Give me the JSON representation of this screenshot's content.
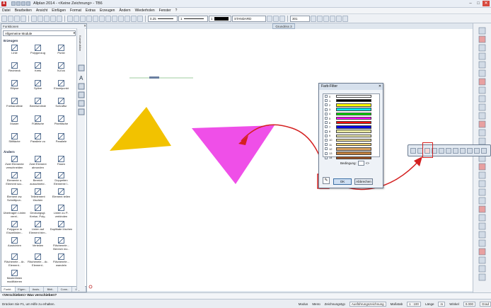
{
  "window": {
    "title": "Allplan 2014 - <Keine Zeichnung> - TB6"
  },
  "menu": [
    "Datei",
    "Bearbeiten",
    "Ansicht",
    "Einfügen",
    "Format",
    "Extras",
    "Erzeugen",
    "Ändern",
    "Wiederholen",
    "Fenster",
    "?"
  ],
  "toolbar": {
    "pen_value": "0.25",
    "line_value": "1",
    "color_value": "1",
    "layer_value": "STANDARD",
    "format_value": "301"
  },
  "document_tab": "Grundriss 3",
  "panel": {
    "title": "Funktionen",
    "module_select": "Allgemeine Module",
    "side_label": "Konstruktion",
    "section_create": "Erzeugen",
    "create_tools": [
      {
        "label": "Linie",
        "icon": "line-icon"
      },
      {
        "label": "Polygonzug",
        "icon": "polyline-icon"
      },
      {
        "label": "Punkt",
        "icon": "point-icon"
      },
      {
        "label": "Rechteck",
        "icon": "rectangle-icon"
      },
      {
        "label": "Kreis",
        "icon": "circle-icon"
      },
      {
        "label": "N-Eck",
        "icon": "polygon-icon"
      },
      {
        "label": "Ellipse",
        "icon": "ellipse-icon"
      },
      {
        "label": "Spline",
        "icon": "spline-icon"
      },
      {
        "label": "Einzelpunkt",
        "icon": "single-point-icon"
      },
      {
        "label": "Freihandlinie",
        "icon": "freehand-icon"
      },
      {
        "label": "Bereisenlinie",
        "icon": "contour-icon"
      },
      {
        "label": "Schraffur",
        "icon": "hatch-icon"
      },
      {
        "label": "Muster",
        "icon": "pattern-icon"
      },
      {
        "label": "Füllfläche",
        "icon": "fill-icon"
      },
      {
        "label": "Pixelfläche",
        "icon": "pixel-fill-icon"
      },
      {
        "label": "Stilfläche",
        "icon": "style-area-icon"
      },
      {
        "label": "Parallele zu",
        "icon": "parallel-icon"
      },
      {
        "label": "Parallele",
        "icon": "parallel-lines-icon"
      }
    ],
    "section_modify": "Ändern",
    "modify_tools": [
      {
        "label": "Zwei Elemente verschneiden",
        "icon": "intersect-icon"
      },
      {
        "label": "Zwei Element abrunden",
        "icon": "fillet-icon"
      },
      {
        "label": "Fasen",
        "icon": "chamfer-icon"
      },
      {
        "label": "Elemente u. Element scu..",
        "icon": "trim-icon"
      },
      {
        "label": "Bereich ausschneid..",
        "icon": "cut-area-icon"
      },
      {
        "label": "Doppelten Elemente l..",
        "icon": "duplicate-icon"
      },
      {
        "label": "Element zw. Schnittpun..",
        "icon": "between-icon"
      },
      {
        "label": "Teilelement löschen",
        "icon": "delete-part-icon"
      },
      {
        "label": "Element teilen",
        "icon": "split-icon"
      },
      {
        "label": "Übertragen Linien verei..",
        "icon": "transfer-icon"
      },
      {
        "label": "Deckungsgl. Kreise, Poly..",
        "icon": "congruent-icon"
      },
      {
        "label": "Linien zu P.. verbinden",
        "icon": "join-icon"
      },
      {
        "label": "Polygone in Einzellinien..",
        "icon": "explode-icon"
      },
      {
        "label": "Linien auf Element trim..",
        "icon": "trim-line-icon"
      },
      {
        "label": "Duplikate löschen",
        "icon": "delete-duplicates-icon"
      },
      {
        "label": "Ausrichten",
        "icon": "align-icon"
      },
      {
        "label": "Verteilen",
        "icon": "distribute-icon"
      },
      {
        "label": "Flächenele... Bereich mo..",
        "icon": "area-modify-icon"
      },
      {
        "label": "Flächenele... Ar-Element..",
        "icon": "area-element-icon"
      },
      {
        "label": "Flächenele... Ar-Element..",
        "icon": "area-element2-icon"
      },
      {
        "label": "Flächenele... wandeln",
        "icon": "area-convert-icon"
      },
      {
        "label": "Musterlinien modifizieren",
        "icon": "pattern-line-icon"
      }
    ],
    "tabs": [
      "Funkt..",
      "Eigen..",
      "Assis..",
      "Bibli..",
      "Conn..",
      "Layer"
    ]
  },
  "dialog": {
    "title": "Farb-Filter",
    "colors": [
      {
        "num": "0",
        "hex": "#ffffff"
      },
      {
        "num": "1",
        "hex": "#000000"
      },
      {
        "num": "2",
        "hex": "#ffff00"
      },
      {
        "num": "3",
        "hex": "#00e5e5"
      },
      {
        "num": "4",
        "hex": "#00e000"
      },
      {
        "num": "5",
        "hex": "#ff00ff"
      },
      {
        "num": "6",
        "hex": "#ff0000"
      },
      {
        "num": "7",
        "hex": "#0000e0"
      },
      {
        "num": "8",
        "hex": "#e8e8a0"
      },
      {
        "num": "9",
        "hex": "#f2f0b0"
      },
      {
        "num": "10",
        "hex": "#e8d890"
      },
      {
        "num": "11",
        "hex": "#f0d070"
      },
      {
        "num": "12",
        "hex": "#d8a060"
      },
      {
        "num": "13",
        "hex": "#c08040"
      },
      {
        "num": "14",
        "hex": "#a05020"
      }
    ],
    "condition_label": "Bedingung:",
    "condition_symbol": "<>",
    "ok": "OK",
    "cancel": "Abbrechen"
  },
  "status": {
    "prompt": "<Verschieben> Was verschieben?",
    "help": "Drücken Sie F1, um Hilfe zu erhalten.",
    "mode_label": "Modus",
    "menu_label": "Menü",
    "drawing_type_label": "Zeichnungstyp",
    "drawing_type_value": "Ausführungszeichnung",
    "scale_label": "Maßstab",
    "scale_value": "1 : 100",
    "length_label": "Länge",
    "length_value": "m",
    "angle_label": "Winkel",
    "angle_value": "0.000",
    "unit_value": "Grad"
  },
  "colors": {
    "accent_red": "#d42020",
    "triangle_yellow": "#f2c200",
    "triangle_magenta": "#ef4fe8"
  }
}
